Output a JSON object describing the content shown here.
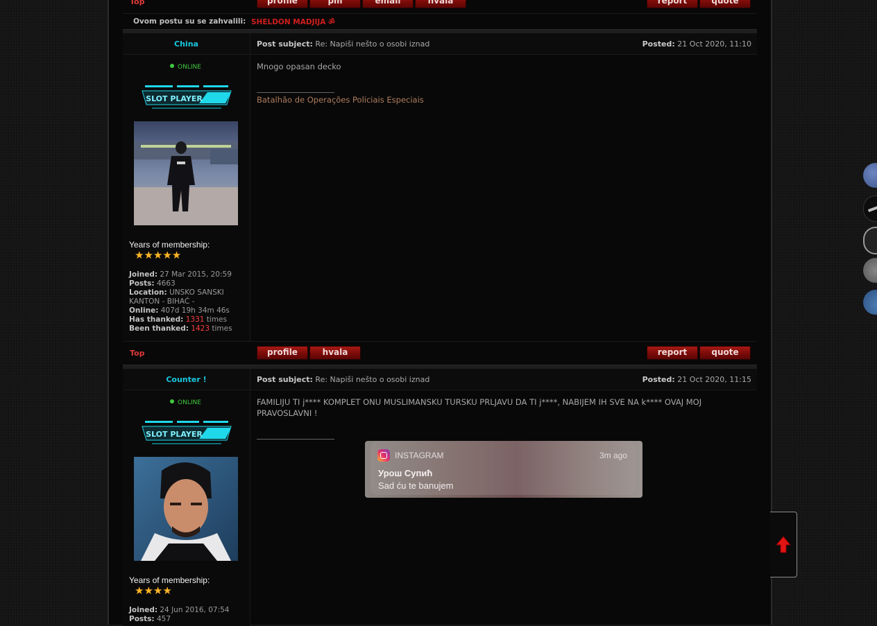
{
  "top_section": {
    "top_link": "Top",
    "buttons_left": [
      "profile",
      "pm",
      "email",
      "hvala"
    ],
    "buttons_right": [
      "report",
      "quote"
    ],
    "thanks_label": "Ovom postu su se zahvalili:",
    "thanks_user": "SHELDON MADJIJA ॐ"
  },
  "posts": [
    {
      "author": "China",
      "status": "ONLINE",
      "rank_text": "SLOT PLAYER",
      "subject_label": "Post subject:",
      "subject": "Re: Napiši nešto o osobi iznad",
      "posted_label": "Posted:",
      "posted": "21 Oct 2020, 11:10",
      "years_label": "Years of membership:",
      "stars": "★★★★★",
      "joined_label": "Joined:",
      "joined": "27 Mar 2015, 20:59",
      "posts_label": "Posts:",
      "posts": "4663",
      "location_label": "Location:",
      "location": "UNSKO SANSKI KANTON - BIHAĆ -",
      "online_label": "Online:",
      "online": "407d 19h 34m 46s",
      "has_thanked_label": "Has thanked:",
      "has_thanked": "1331",
      "been_thanked_label": "Been thanked:",
      "been_thanked": "1423",
      "times": "times",
      "body": "Mnogo opasan decko",
      "signature": "Batalhão de Operações Policiais Especiais",
      "footer_top": "Top",
      "footer_buttons_left": [
        "profile",
        "hvala"
      ],
      "footer_buttons_right": [
        "report",
        "quote"
      ]
    },
    {
      "author": "Counter !",
      "status": "ONLINE",
      "rank_text": "SLOT PLAYER",
      "subject_label": "Post subject:",
      "subject": "Re: Napiši nešto o osobi iznad",
      "posted_label": "Posted:",
      "posted": "21 Oct 2020, 11:15",
      "years_label": "Years of membership:",
      "stars": "★★★★",
      "joined_label": "Joined:",
      "joined": "24 Jun 2016, 07:54",
      "posts_label": "Posts:",
      "posts": "457",
      "body": "FAMILIJU TI j**** KOMPLET ONU MUSLIMANSKU TURSKU PRLJAVU DA TI j****, NABIJEM IH SVE NA k**** OVAJ MOJ PRAVOSLAVNI !",
      "notification": {
        "app": "INSTAGRAM",
        "time": "3m ago",
        "title": "Урош Супић",
        "message": "Sad ću te banujem"
      }
    }
  ],
  "colors": {
    "accent_cyan": "#19c8e0",
    "button_red": "#8a0f0b",
    "online_green": "#3ec93e",
    "signature": "#b07d5e"
  }
}
